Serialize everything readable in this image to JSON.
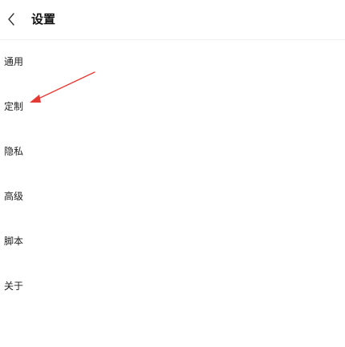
{
  "header": {
    "back_icon": "chevron-left-icon",
    "title": "设置"
  },
  "menu": {
    "items": [
      {
        "label": "通用"
      },
      {
        "label": "定制"
      },
      {
        "label": "隐私"
      },
      {
        "label": "高级"
      },
      {
        "label": "脚本"
      },
      {
        "label": "关于"
      }
    ]
  },
  "annotation": {
    "type": "arrow",
    "color": "#e53935",
    "points_to": "定制"
  }
}
